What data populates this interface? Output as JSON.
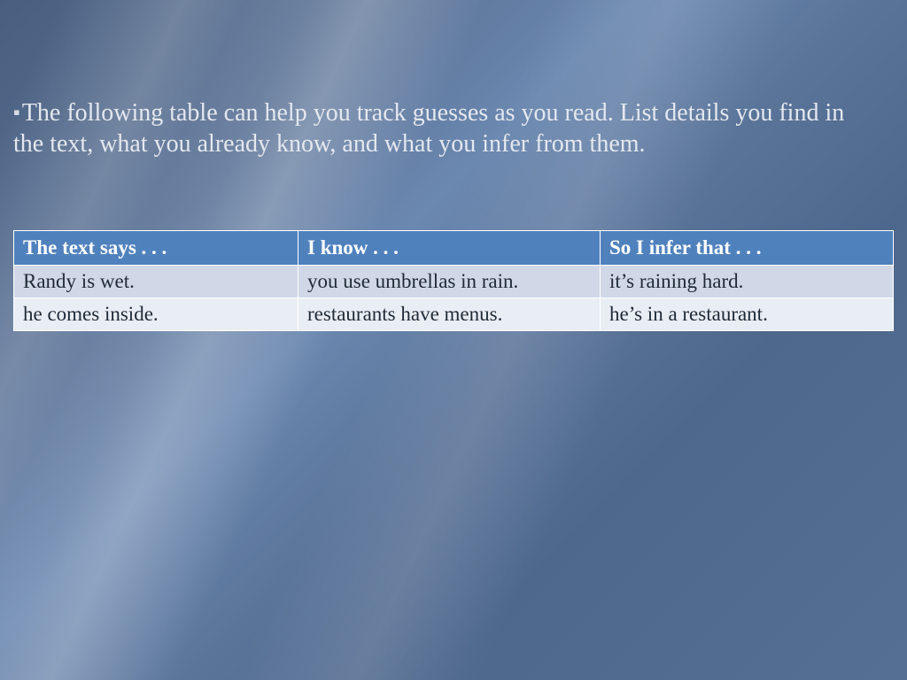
{
  "intro": {
    "bullet": "▪",
    "text": "The following table can help you track guesses as you read. List details you find in the text, what you already know, and what you infer from them."
  },
  "table": {
    "headers": [
      "The text says . . .",
      "I know . . .",
      "So I infer that . . ."
    ],
    "rows": [
      [
        "Randy is wet.",
        "you use umbrellas in rain.",
        "it’s raining hard."
      ],
      [
        "he comes inside.",
        "restaurants have menus.",
        "he’s in a restaurant."
      ]
    ]
  }
}
